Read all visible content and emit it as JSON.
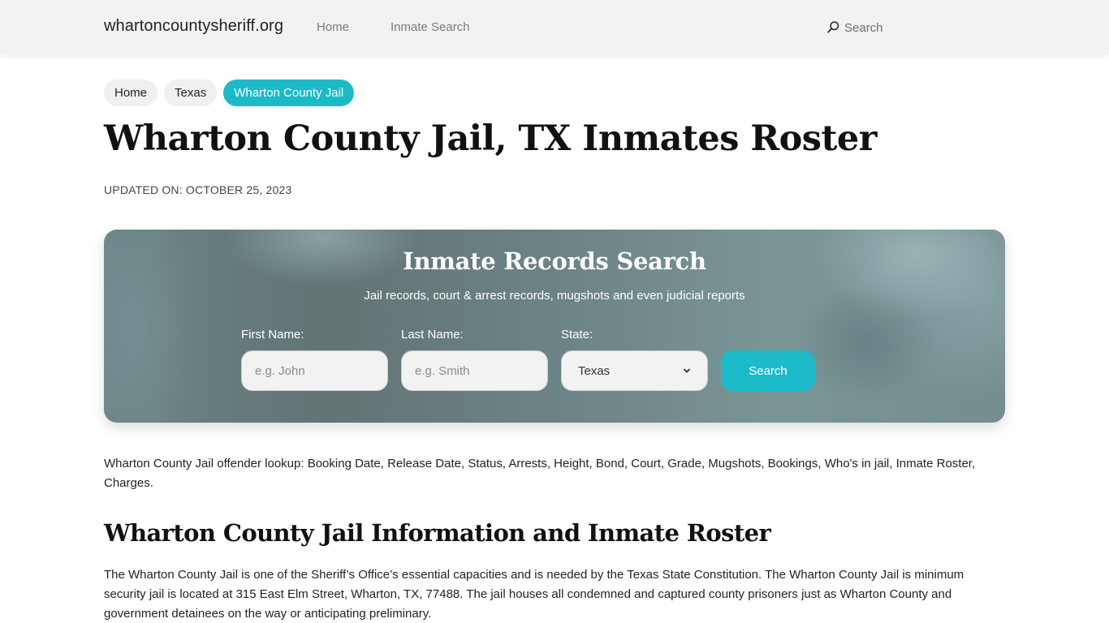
{
  "header": {
    "brand": "whartoncountysheriff.org",
    "nav": [
      {
        "label": "Home"
      },
      {
        "label": "Inmate Search"
      }
    ],
    "search": {
      "icon": "search-icon",
      "label": "Search"
    }
  },
  "breadcrumb": [
    {
      "label": "Home",
      "active": false
    },
    {
      "label": "Texas",
      "active": false
    },
    {
      "label": "Wharton County Jail",
      "active": true
    }
  ],
  "page": {
    "title": "Wharton County Jail, TX Inmates Roster",
    "updated": "UPDATED ON: OCTOBER 25, 2023"
  },
  "search_panel": {
    "title": "Inmate Records Search",
    "subtitle": "Jail records, court & arrest records, mugshots and even judicial reports",
    "first_name": {
      "label": "First Name:",
      "placeholder": "e.g. John",
      "value": ""
    },
    "last_name": {
      "label": "Last Name:",
      "placeholder": "e.g. Smith",
      "value": ""
    },
    "state": {
      "label": "State:",
      "selected": "Texas",
      "icon": "chevron-down-icon"
    },
    "submit_label": "Search"
  },
  "content": {
    "intro": "Wharton County Jail offender lookup: Booking Date, Release Date, Status, Arrests, Height, Bond, Court, Grade, Mugshots, Bookings, Who's in jail, Inmate Roster, Charges.",
    "section_heading": "Wharton County Jail Information and Inmate Roster",
    "section_paragraph": "The Wharton County Jail is one of the Sheriff’s Office’s essential capacities and is needed by the Texas State Constitution. The Wharton County Jail is minimum security jail is located at 315 East Elm Street, Wharton, TX, 77488. The jail houses all condemned and captured county prisoners just as Wharton County and government detainees on the way or anticipating preliminary."
  },
  "colors": {
    "accent": "#1cbac8",
    "header_bg": "#f2f2f2",
    "crumb_bg": "#f0f0f0"
  }
}
